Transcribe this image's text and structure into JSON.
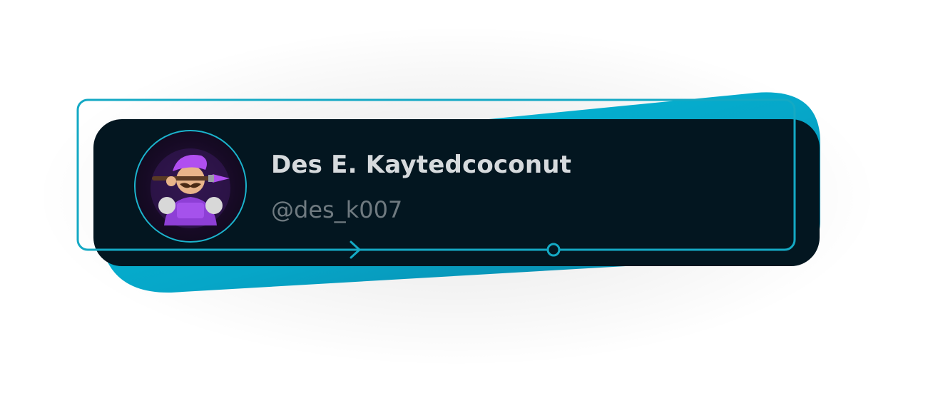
{
  "profile": {
    "display_name": "Des E. Kaytedcoconut",
    "handle": "@des_k007",
    "avatar_icon": "painter-mascot-icon"
  },
  "theme": {
    "card_background": "#031620",
    "accent": "#00b4d8",
    "accent_dark": "#0a8fb0",
    "name_color": "#d6dadd",
    "handle_color": "#6f7a80"
  },
  "decor": {
    "arrow_icon": "arrow-right-icon",
    "node_icon": "circle-node-icon"
  }
}
